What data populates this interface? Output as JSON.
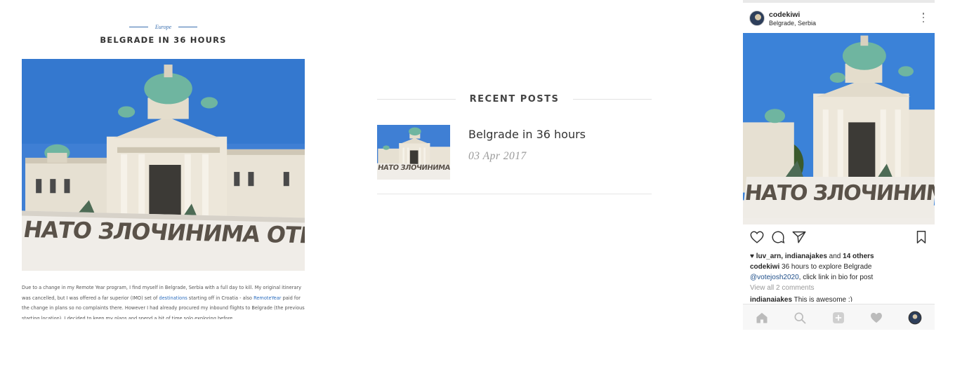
{
  "post": {
    "category": "Europe",
    "title": "BELGRADE IN 36 HOURS",
    "body_1": "Due to a change in my Remote Year program, I find myself in Belgrade, Serbia with a full day to kill. My original itinerary was cancelled, but I was offered a far superior (IMO) set of ",
    "body_link_1": "destinations",
    "body_2": " starting off in Croatia - also ",
    "body_link_2": "RemoteYear",
    "body_3": " paid for the change in plans so no complaints there. However I had already procured my inbound flights to Belgrade (the previous starting location). I decided to keep my plans and spend a bit of time solo exploring before",
    "banner_text": "НАТО ЗЛОЧИНИМА ОТЕЛИ КО"
  },
  "recent": {
    "heading": "RECENT POSTS",
    "items": [
      {
        "title": "Belgrade in 36 hours",
        "date": "03 Apr 2017",
        "banner_text": "НАТО ЗЛОЧИНИМА ОТЕЛИ"
      }
    ]
  },
  "instagram": {
    "username": "codekiwi",
    "location": "Belgrade, Serbia",
    "banner_text": "НАТО ЗЛОЧИНИМА ОТЕЛ",
    "liked_by": "luv_arn, indianajakes",
    "likes_and": " and ",
    "likes_others": "14 others",
    "caption_user": "codekiwi",
    "caption_text": " 36 hours to explore Belgrade",
    "caption_mention": "@votejosh2020",
    "caption_rest": ", click link in bio for post",
    "view_all": "View all 2 comments",
    "comment_user": "indianajakes",
    "comment_text": " This is awesome :)"
  },
  "colors": {
    "link": "#2e6fbf",
    "sky": "#3f7fd4",
    "building": "#e9e3d6",
    "dome": "#6fb5a0"
  },
  "icons": [
    "heart-icon",
    "comment-icon",
    "share-icon",
    "bookmark-icon",
    "home-icon",
    "search-icon",
    "add-icon",
    "activity-icon",
    "profile-icon",
    "more-icon"
  ]
}
